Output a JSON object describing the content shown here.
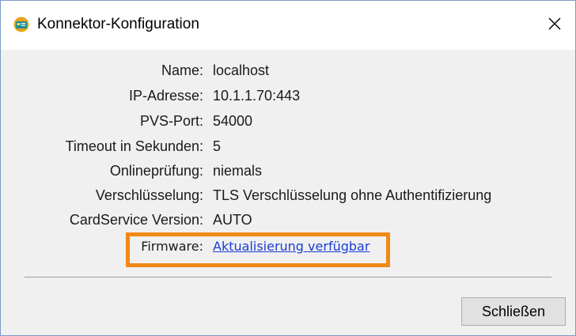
{
  "window": {
    "title": "Konnektor-Konfiguration",
    "app_icon": "connector-card-icon",
    "close_icon": "close-icon"
  },
  "fields": [
    {
      "label": "Name:",
      "value": "localhost"
    },
    {
      "label": "IP-Adresse:",
      "value": "10.1.1.70:443"
    },
    {
      "label": "PVS-Port:",
      "value": "54000"
    },
    {
      "label": "Timeout in Sekunden:",
      "value": "5"
    },
    {
      "label": "Onlineprüfung:",
      "value": "niemals"
    },
    {
      "label": "Verschlüsselung:",
      "value": "TLS Verschlüsselung ohne Authentifizierung"
    },
    {
      "label": "CardService Version:",
      "value": "AUTO"
    }
  ],
  "firmware": {
    "label": "Firmware:",
    "link_text": "Aktualisierung verfügbar"
  },
  "buttons": {
    "close_label": "Schließen"
  },
  "colors": {
    "highlight": "#f08a16",
    "link": "#1a3dd6",
    "window_border": "#7a9cc6"
  }
}
